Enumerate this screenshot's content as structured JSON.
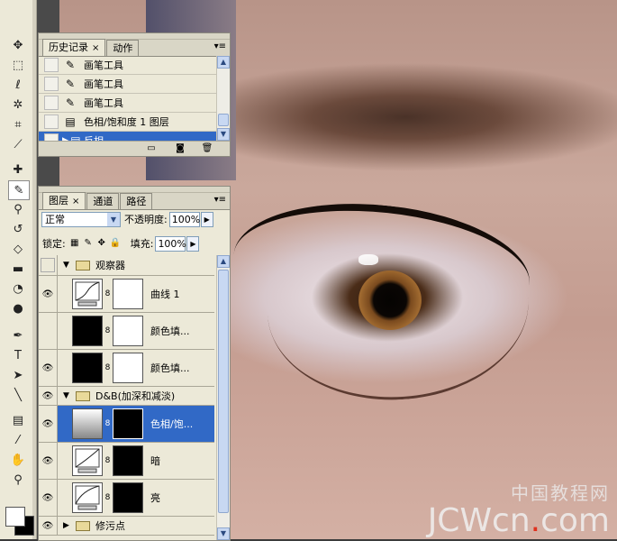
{
  "history_panel": {
    "tabs": [
      {
        "label": "历史记录",
        "active": true
      },
      {
        "label": "动作",
        "active": false
      }
    ],
    "items": [
      {
        "label": "画笔工具",
        "icon": "brush-icon",
        "selected": false
      },
      {
        "label": "画笔工具",
        "icon": "brush-icon",
        "selected": false
      },
      {
        "label": "画笔工具",
        "icon": "brush-icon",
        "selected": false
      },
      {
        "label": "色相/饱和度 1 图层",
        "icon": "document-icon",
        "selected": false
      },
      {
        "label": "反相",
        "icon": "document-icon",
        "selected": true
      }
    ]
  },
  "layers_panel": {
    "tabs": [
      {
        "label": "图层",
        "active": true
      },
      {
        "label": "通道",
        "active": false
      },
      {
        "label": "路径",
        "active": false
      }
    ],
    "blend_mode": "正常",
    "opacity_label": "不透明度:",
    "opacity_value": "100%",
    "lock_label": "锁定:",
    "fill_label": "填充:",
    "fill_value": "100%",
    "layers": [
      {
        "type": "group",
        "name": "观察器",
        "visible": false
      },
      {
        "type": "layer",
        "name": "曲线 1",
        "thumb": "adjustment",
        "mask": "white",
        "visible": true
      },
      {
        "type": "layer",
        "name": "颜色填...",
        "thumb": "black",
        "mask": "white",
        "visible": false
      },
      {
        "type": "layer",
        "name": "颜色填...",
        "thumb": "black",
        "mask": "white",
        "visible": true
      },
      {
        "type": "group",
        "name": "D&B(加深和减淡)",
        "visible": true
      },
      {
        "type": "layer",
        "name": "色相/饱...",
        "thumb": "gradient",
        "mask": "black",
        "visible": true,
        "selected": true
      },
      {
        "type": "layer",
        "name": "暗",
        "thumb": "adjustment",
        "mask": "black",
        "visible": true
      },
      {
        "type": "layer",
        "name": "亮",
        "thumb": "adjustment",
        "mask": "black",
        "visible": true
      },
      {
        "type": "group",
        "name": "修污点",
        "visible": true
      }
    ]
  },
  "watermark": {
    "cn": "中国教程网",
    "en_prefix": "JCWcn",
    "en_dot": ".",
    "en_suffix": "com"
  },
  "colors": {
    "selection": "#3169c6",
    "panel_bg": "#ece9d8",
    "watermark_dot": "#e0301e"
  }
}
